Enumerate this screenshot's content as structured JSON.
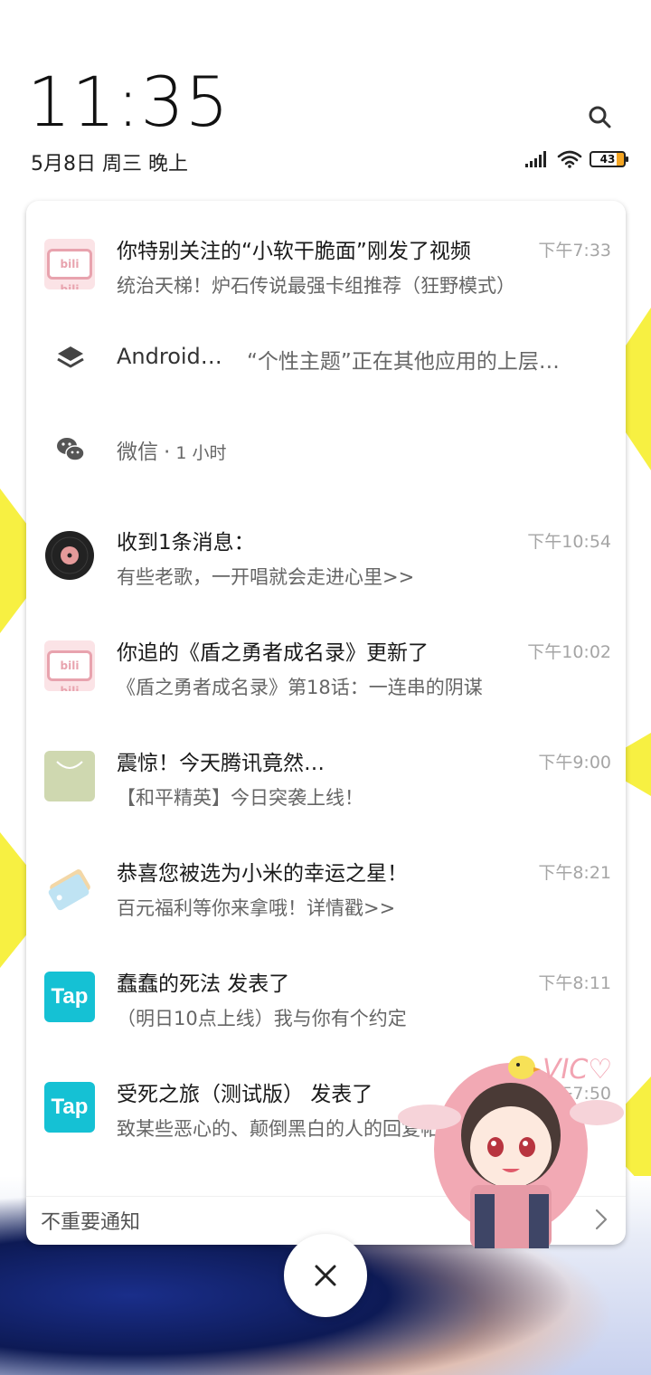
{
  "lockscreen": {
    "time": "11:35",
    "date": "5月8日 周三 晚上",
    "battery_level": "43"
  },
  "notifications": [
    {
      "app": "bilibili",
      "icon": "bilibili-tv-icon",
      "title": "你特别关注的“小软干脆面”刚发了视频",
      "body": "统治天梯！炉石传说最强卡组推荐（狂野模式）",
      "time": "下午7:33"
    },
    {
      "app": "Android…",
      "icon": "layers-icon",
      "summary": "“个性主题”正在其他应用的上层…"
    },
    {
      "app": "微信",
      "icon": "wechat-icon",
      "age": "1 小时"
    },
    {
      "app": "music",
      "icon": "vinyl-record-icon",
      "title": "收到1条消息：",
      "body": "有些老歌，一开唱就会走进心里>>",
      "time": "下午10:54"
    },
    {
      "app": "bilibili",
      "icon": "bilibili-tv-icon",
      "title": "你追的《盾之勇者成名录》更新了",
      "body": "《盾之勇者成名录》第18话：一连串的阴谋",
      "time": "下午10:02"
    },
    {
      "app": "app-store",
      "icon": "shopping-bag-icon",
      "title": "震惊！今天腾讯竟然…",
      "body": "【和平精英】今日突袭上线！",
      "time": "下午9:00"
    },
    {
      "app": "mi-coupon",
      "icon": "mi-tag-icon",
      "title": "恭喜您被选为小米的幸运之星！",
      "body": "百元福利等你来拿哦！详情戳>>",
      "time": "下午8:21"
    },
    {
      "app": "taptap",
      "icon": "taptap-icon",
      "icon_text": "Tap",
      "title": "蠢蠢的死法  发表了",
      "body": "（明日10点上线）我与你有个约定",
      "time": "下午8:11"
    },
    {
      "app": "taptap",
      "icon": "taptap-icon",
      "icon_text": "Tap",
      "title": "受死之旅（测试版）  发表了",
      "body": "致某些恶心的、颠倒黑白的人的回复帖子，另外这…",
      "time": "下午7:50"
    }
  ],
  "unimportant": {
    "label": "不重要通知"
  },
  "colors": {
    "tap_cyan": "#15c1d4",
    "bili_pink": "#e8a3ae",
    "wallpaper_yellow": "#f7f042"
  }
}
